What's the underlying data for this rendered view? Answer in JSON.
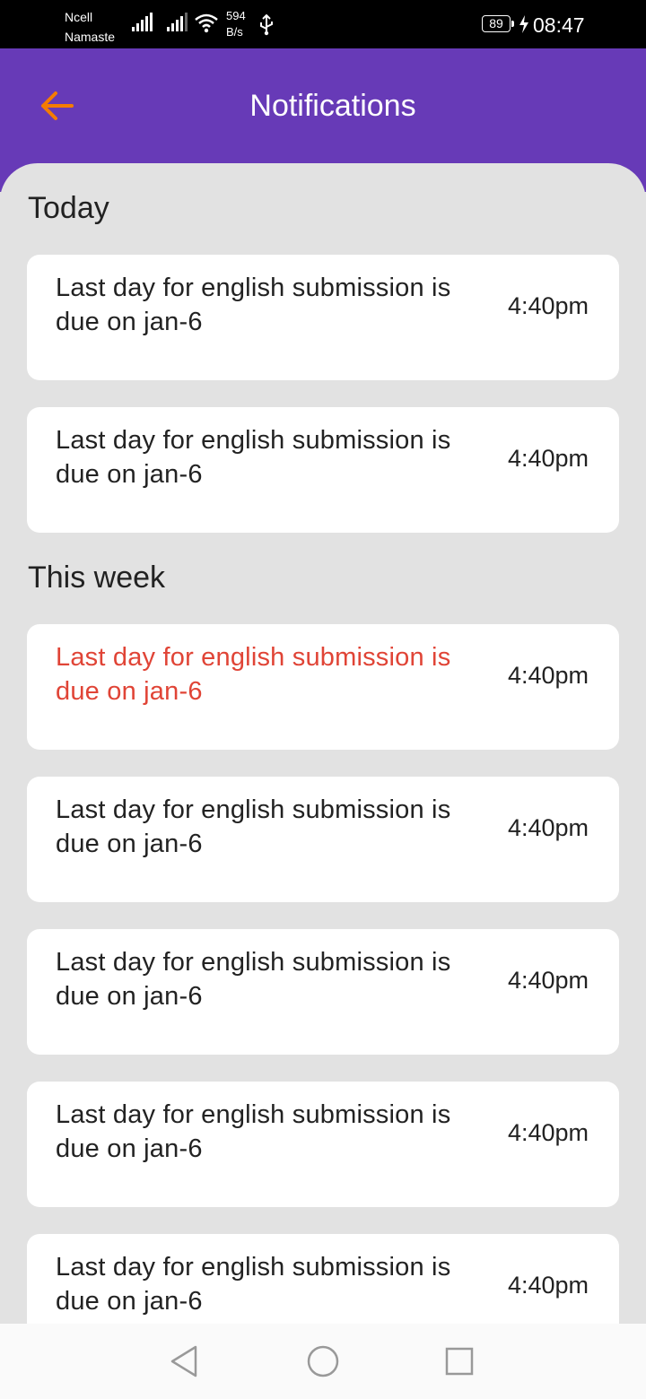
{
  "status_bar": {
    "carrier_primary": "Ncell",
    "carrier_secondary": "Namaste",
    "speed_value": "594",
    "speed_unit": "B/s",
    "battery_level": "89",
    "time": "08:47",
    "icons": [
      "signal-icon",
      "signal-icon",
      "wifi-icon",
      "usb-icon",
      "battery-icon",
      "charging-icon"
    ]
  },
  "header": {
    "title": "Notifications",
    "back_icon": "arrow-left-icon",
    "back_icon_color": "#f57c00",
    "background_color": "#673ab7"
  },
  "sections": [
    {
      "heading": "Today",
      "items": [
        {
          "message": "Last day for english submission is due on jan-6",
          "time": "4:40pm",
          "highlight": false
        },
        {
          "message": "Last day for english submission is due on jan-6",
          "time": "4:40pm",
          "highlight": false
        }
      ]
    },
    {
      "heading": "This week",
      "items": [
        {
          "message": "Last day for english submission is due on jan-6",
          "time": "4:40pm",
          "highlight": true
        },
        {
          "message": "Last day for english submission is due on jan-6",
          "time": "4:40pm",
          "highlight": false
        },
        {
          "message": "Last day for english submission is due on jan-6",
          "time": "4:40pm",
          "highlight": false
        },
        {
          "message": "Last day for english submission is due on jan-6",
          "time": "4:40pm",
          "highlight": false
        },
        {
          "message": "Last day for english submission is due on jan-6",
          "time": "4:40pm",
          "highlight": false
        }
      ]
    }
  ],
  "highlight_color": "#e04436",
  "nav_bar": {
    "icons": [
      "back-triangle-icon",
      "home-circle-icon",
      "recents-square-icon"
    ]
  }
}
